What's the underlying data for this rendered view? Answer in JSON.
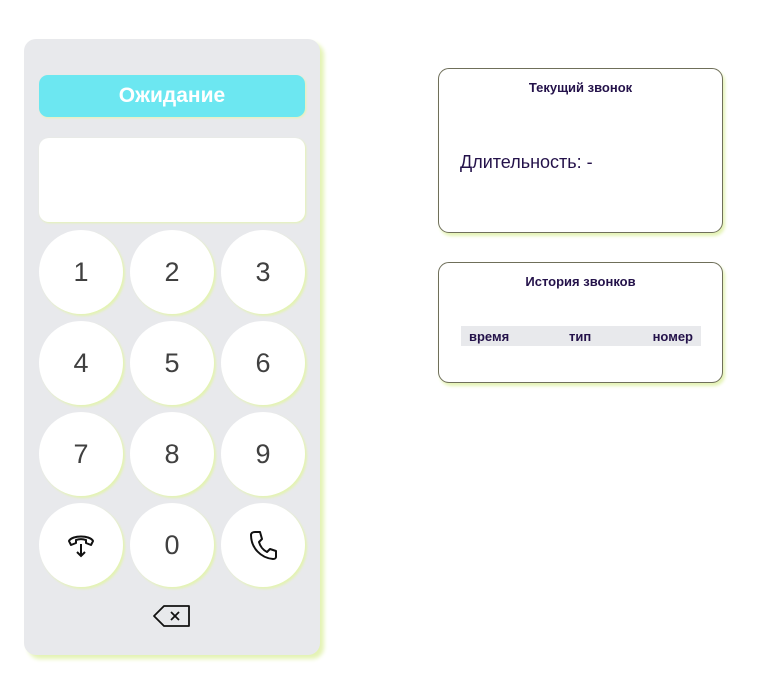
{
  "phone": {
    "status": "Ожидание",
    "display_value": "",
    "keys": [
      "1",
      "2",
      "3",
      "4",
      "5",
      "6",
      "7",
      "8",
      "9",
      "0"
    ],
    "hangup_icon": "hangup-icon",
    "call_icon": "phone-call-icon",
    "backspace_icon": "backspace-icon"
  },
  "current_call": {
    "title": "Текущий звонок",
    "duration_label": "Длительность: -"
  },
  "history": {
    "title": "История звонков",
    "columns": [
      "время",
      "тип",
      "номер"
    ]
  },
  "colors": {
    "status_bg": "#6ce7f1",
    "panel_bg": "#e8e9ec",
    "shadow": "#e4f3b4",
    "text_dark": "#24124a"
  }
}
